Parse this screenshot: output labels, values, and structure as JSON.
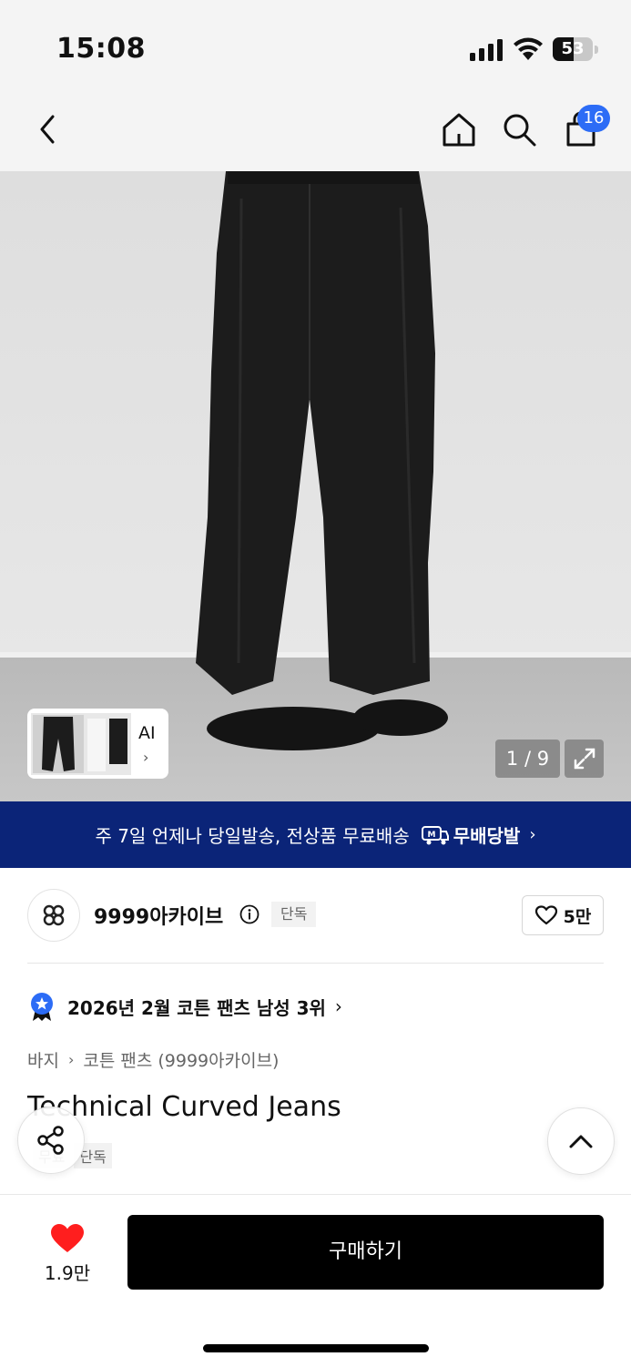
{
  "status_bar": {
    "time": "15:08",
    "battery_level": "53",
    "icons": [
      "signal-icon",
      "wifi-icon",
      "battery-icon"
    ]
  },
  "nav": {
    "icons": [
      "back-icon",
      "home-icon",
      "search-icon",
      "cart-icon"
    ],
    "cart_badge": "16"
  },
  "gallery": {
    "ai_label": "AI",
    "counter": "1 / 9",
    "icons": [
      "expand-icon",
      "chevron-right-icon"
    ]
  },
  "promo": {
    "text": "주 7일 언제나 당일발송, 전상품 무료배송",
    "logo_text": "무배당발",
    "logo_mark": "M"
  },
  "store": {
    "name": "9999아카이브",
    "badge": "단독",
    "like_count": "5만",
    "icons": [
      "store-logo-icon",
      "info-icon",
      "heart-outline-icon"
    ]
  },
  "ranking": {
    "text": "2026년 2월 코튼 팬츠 남성 3위",
    "icon": "ranking-medal-icon"
  },
  "breadcrumb": {
    "items": [
      "바지",
      "코튼 팬츠 (9999아카이브)"
    ]
  },
  "product": {
    "title": "Technical Curved Jeans",
    "tags": [
      "무료",
      "단독"
    ]
  },
  "floating": {
    "icons": [
      "share-icon",
      "chevron-up-icon"
    ]
  },
  "bottom_bar": {
    "wish_count": "1.9만",
    "buy_label": "구매하기",
    "accent_color": "#ff1e1e",
    "icons": [
      "heart-filled-icon"
    ]
  },
  "colors": {
    "promo_bg": "#0b2478",
    "badge_blue": "#2c6cf6",
    "buy_bg": "#000000"
  }
}
